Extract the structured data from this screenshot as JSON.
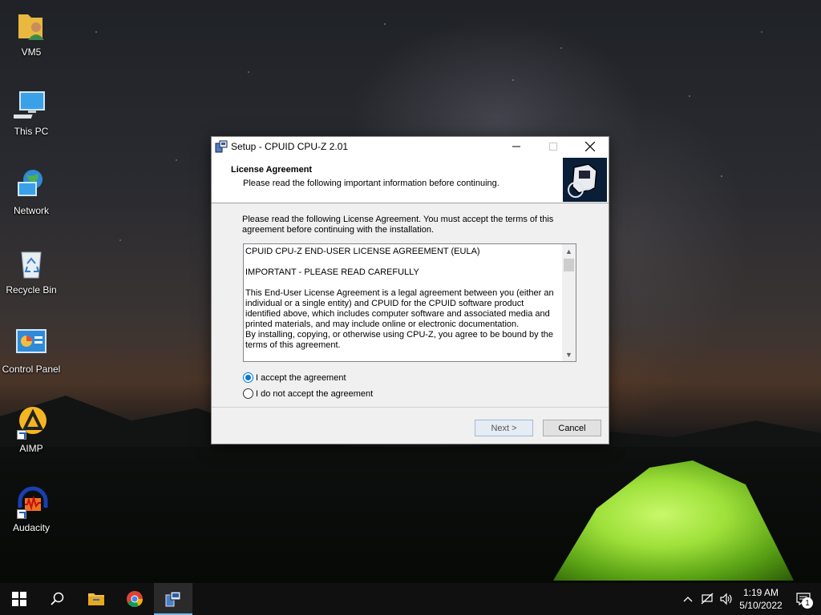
{
  "desktop": {
    "icons": [
      {
        "label": "VM5"
      },
      {
        "label": "This PC"
      },
      {
        "label": "Network"
      },
      {
        "label": "Recycle Bin"
      },
      {
        "label": "Control Panel"
      },
      {
        "label": "AIMP"
      },
      {
        "label": "Audacity"
      }
    ]
  },
  "dialog": {
    "title": "Setup - CPUID CPU-Z 2.01",
    "header_title": "License Agreement",
    "header_subtitle": "Please read the following important information before continuing.",
    "intro": "Please read the following License Agreement. You must accept the terms of this agreement before continuing with the installation.",
    "license": {
      "line1": "CPUID CPU-Z END-USER LICENSE AGREEMENT (EULA)",
      "line2": "IMPORTANT - PLEASE READ CAREFULLY",
      "line3": "This End-User License Agreement is a legal agreement between you (either an individual or a single entity) and CPUID for the CPUID software product identified above, which includes computer software and associated media and printed materials, and may include online or electronic documentation.",
      "line4": "By installing, copying, or otherwise using CPU-Z, you agree to be bound by the terms of this agreement."
    },
    "accept_label": "I accept the agreement",
    "decline_label": "I do not accept the agreement",
    "accept_selected": true,
    "next_label": "Next >",
    "cancel_label": "Cancel"
  },
  "taskbar": {
    "time": "1:19 AM",
    "date": "5/10/2022",
    "notification_count": "1",
    "accent": "#76b9ed"
  }
}
